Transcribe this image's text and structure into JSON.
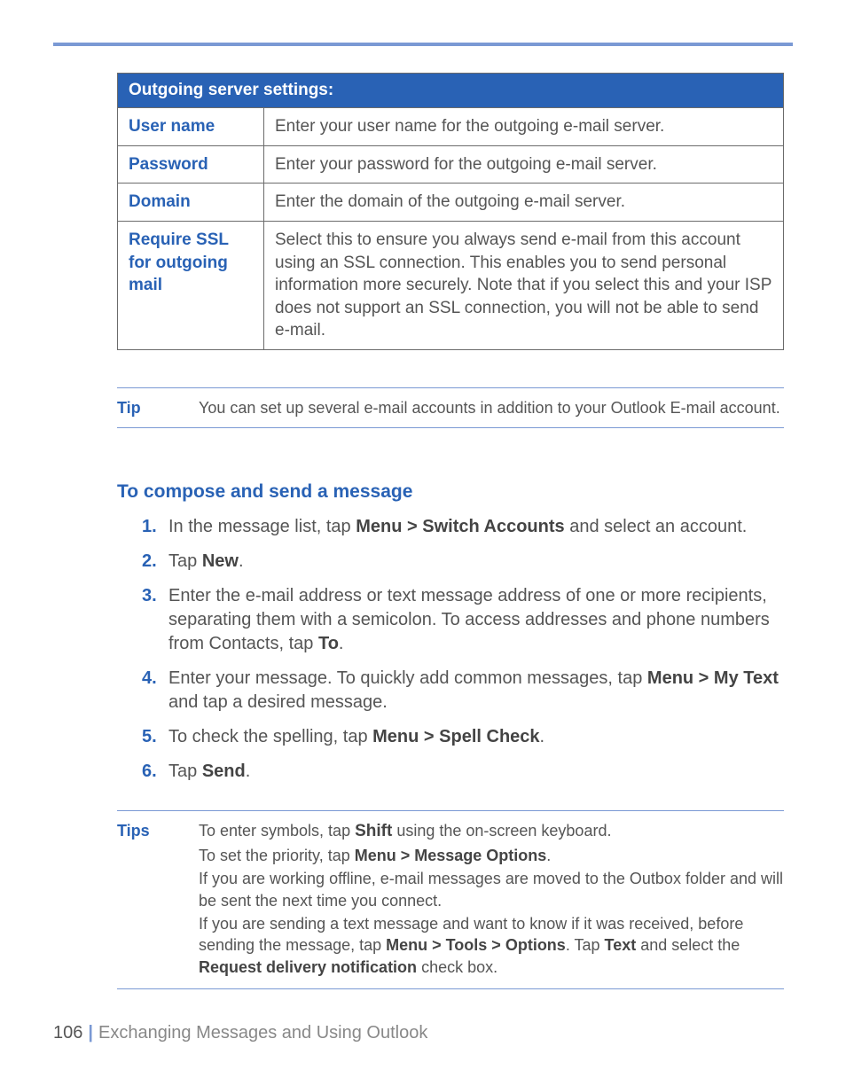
{
  "table": {
    "header": "Outgoing server settings:",
    "rows": [
      {
        "label": "User name",
        "desc": "Enter your user name for the outgoing e-mail server."
      },
      {
        "label": "Password",
        "desc": "Enter your password for the outgoing e-mail server."
      },
      {
        "label": "Domain",
        "desc": "Enter the domain of the outgoing e-mail server."
      },
      {
        "label": "Require SSL for outgoing mail",
        "desc": "Select this to ensure you always send e-mail from this account using an SSL connection. This enables you to send personal information more securely. Note that if you select this and your ISP does not support an SSL connection, you will not be able to send e-mail."
      }
    ]
  },
  "tip1": {
    "label": "Tip",
    "text": "You can set up several e-mail accounts in addition to your Outlook E-mail account."
  },
  "section_heading": "To compose and send a message",
  "steps": {
    "s1a": "In the message list, tap ",
    "s1b": "Menu > Switch Accounts",
    "s1c": " and select an account.",
    "s2a": "Tap ",
    "s2b": "New",
    "s2c": ".",
    "s3a": "Enter the e-mail address or text message address of one or more recipients, separating them with a semicolon. To access addresses and phone numbers from Contacts, tap ",
    "s3b": "To",
    "s3c": ".",
    "s4a": "Enter your message. To quickly add common messages, tap ",
    "s4b": "Menu > My Text",
    "s4c": " and tap a desired message.",
    "s5a": "To check the spelling, tap ",
    "s5b": "Menu > Spell Check",
    "s5c": ".",
    "s6a": "Tap ",
    "s6b": "Send",
    "s6c": "."
  },
  "tips2": {
    "label": "Tips",
    "l1a": "To enter symbols, tap ",
    "l1b": "Shift",
    "l1c": " using the on-screen keyboard.",
    "l2a": "To set the priority, tap ",
    "l2b": "Menu > Message Options",
    "l2c": ".",
    "l3": "If you are working offline, e-mail messages are moved to the Outbox folder and will be sent the next time you connect.",
    "l4a": "If you are sending a text message and want to know if it was received, before sending the message, tap ",
    "l4b": "Menu > Tools > Options",
    "l4c": ". Tap ",
    "l4d": "Text",
    "l4e": " and select the ",
    "l4f": "Request delivery notification",
    "l4g": " check box."
  },
  "footer": {
    "page": "106",
    "title": "Exchanging Messages and Using Outlook"
  }
}
